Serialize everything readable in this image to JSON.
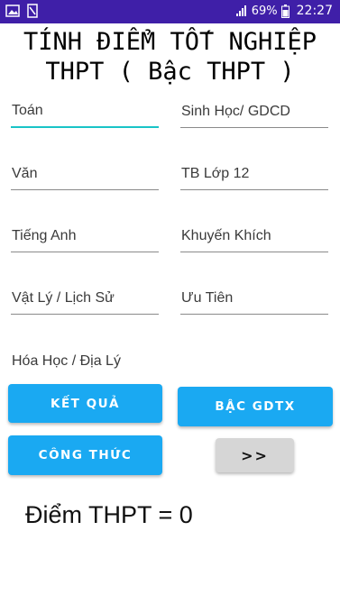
{
  "status_bar": {
    "icons_left": [
      "image-icon",
      "file-icon"
    ],
    "battery_percent": "69%",
    "time": "22:27"
  },
  "title": {
    "line1": "TÍNH ĐIỂM TỐT NGHIỆP",
    "line2": "THPT ( Bậc THPT )"
  },
  "fields": {
    "toan": "Toán",
    "sinh_gdcd": "Sinh Học/ GDCD",
    "van": "Văn",
    "tb_lop12": "TB Lớp 12",
    "tieng_anh": "Tiếng Anh",
    "khuyen_khich": "Khuyến Khích",
    "vatly_lichsu": "Vật Lý / Lịch Sử",
    "uu_tien": "Ưu Tiên",
    "hoahoc_dialy": "Hóa Học / Địa Lý"
  },
  "buttons": {
    "ket_qua": "KẾT QUẢ",
    "bac_gdtx": "BẬC GDTX",
    "cong_thuc": "CÔNG THỨC",
    "next": ">>"
  },
  "result": {
    "label": "Điểm THPT = ",
    "value": "0"
  },
  "colors": {
    "status_bar": "#3f1fa8",
    "accent_button": "#1aa9f2",
    "active_underline": "#19c4c7",
    "grey_button": "#d6d6d6"
  }
}
